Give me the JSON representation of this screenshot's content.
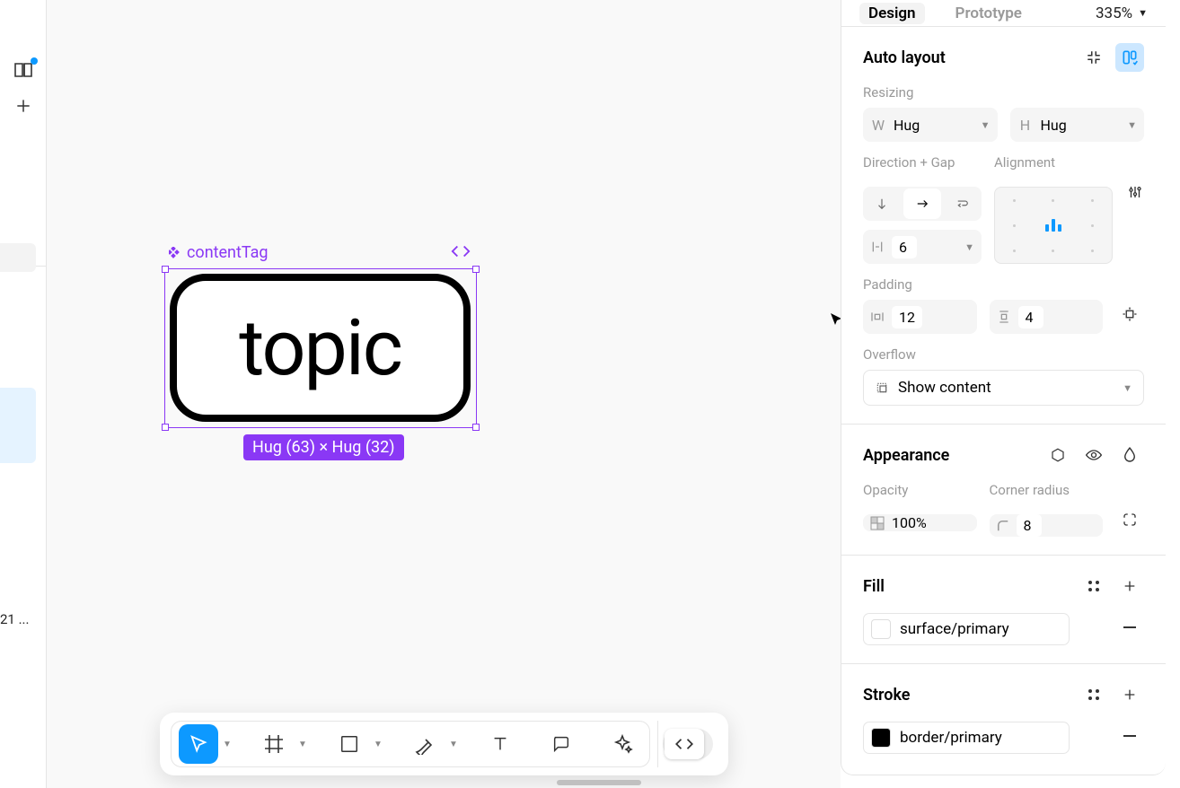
{
  "tabs": {
    "design": "Design",
    "prototype": "Prototype",
    "zoom": "335%"
  },
  "leftRail": {
    "truncatedText": "21 ..."
  },
  "canvas": {
    "componentName": "contentTag",
    "componentText": "topic",
    "dimensions": "Hug (63) × Hug (32)"
  },
  "autoLayout": {
    "title": "Auto layout",
    "resizingLabel": "Resizing",
    "widthLabel": "W",
    "widthValue": "Hug",
    "heightLabel": "H",
    "heightValue": "Hug",
    "directionGapLabel": "Direction + Gap",
    "alignmentLabel": "Alignment",
    "gapValue": "6",
    "paddingLabel": "Padding",
    "padH": "12",
    "padV": "4",
    "overflowLabel": "Overflow",
    "overflowValue": "Show content"
  },
  "appearance": {
    "title": "Appearance",
    "opacityLabel": "Opacity",
    "opacityValue": "100%",
    "radiusLabel": "Corner radius",
    "radiusValue": "8"
  },
  "fill": {
    "title": "Fill",
    "value": "surface/primary"
  },
  "stroke": {
    "title": "Stroke",
    "value": "border/primary"
  }
}
